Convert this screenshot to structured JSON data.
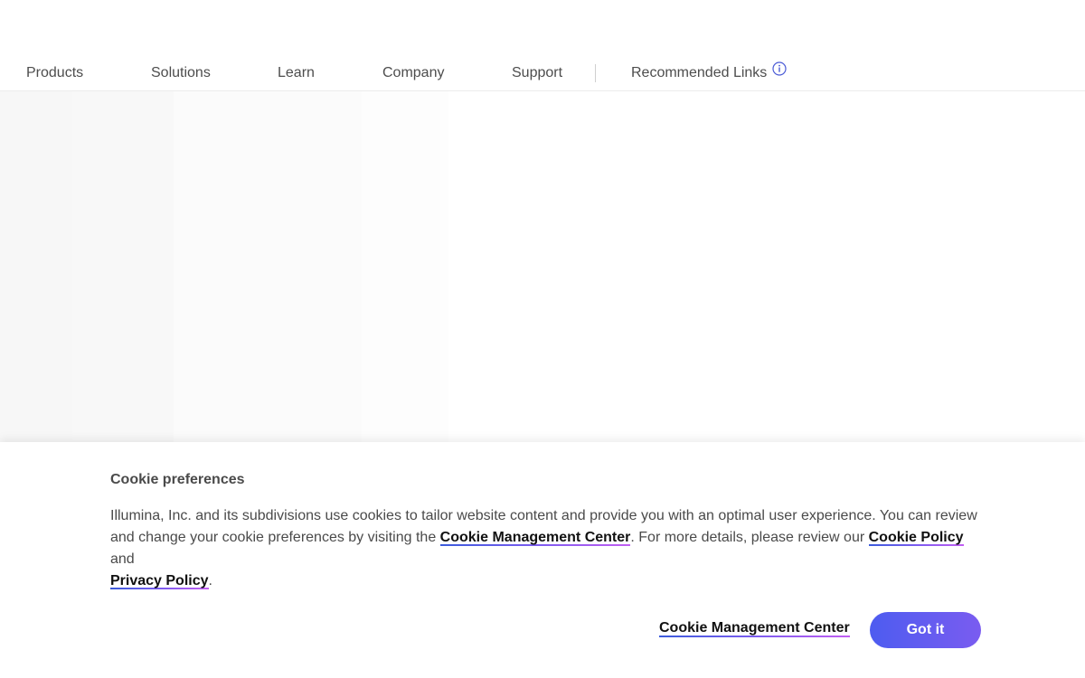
{
  "nav": {
    "items": [
      {
        "label": "Products"
      },
      {
        "label": "Solutions"
      },
      {
        "label": "Learn"
      },
      {
        "label": "Company"
      },
      {
        "label": "Support"
      }
    ],
    "recommended": {
      "label": "Recommended Links",
      "icon": "info-icon"
    }
  },
  "cookie": {
    "title": "Cookie preferences",
    "text_part1": "Illumina, Inc. and its subdivisions use cookies to tailor website content and provide you with an optimal user experience. You can review and change your cookie preferences by visiting the ",
    "link_management": "Cookie Management Center",
    "text_part2": ". For more details, please review our ",
    "link_cookie_policy": "Cookie Policy",
    "text_part3": " and ",
    "link_privacy_policy": "Privacy Policy",
    "text_part4": ".",
    "button_link": "Cookie Management Center",
    "button_primary": "Got it"
  },
  "colors": {
    "accent_start": "#4d5cf0",
    "accent_end": "#7a5cf0",
    "info_icon": "#4b5bd6"
  }
}
